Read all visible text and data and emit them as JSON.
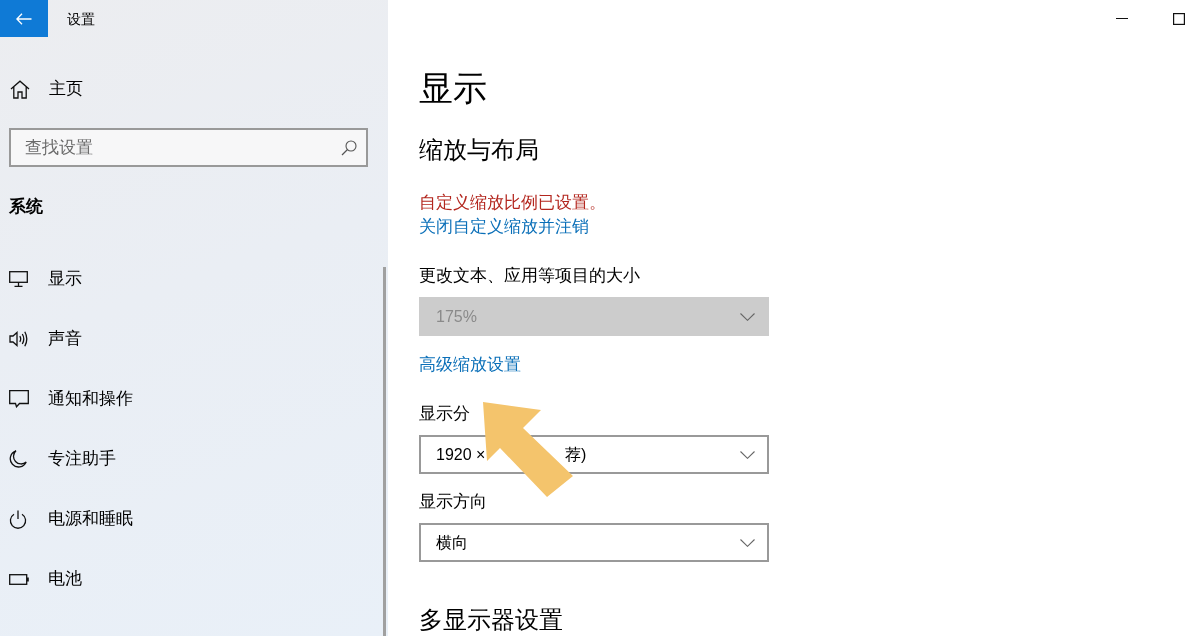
{
  "window": {
    "title": "设置"
  },
  "sidebar": {
    "home": {
      "label": "主页"
    },
    "search": {
      "placeholder": "查找设置"
    },
    "section": "系统",
    "items": [
      {
        "label": "显示"
      },
      {
        "label": "声音"
      },
      {
        "label": "通知和操作"
      },
      {
        "label": "专注助手"
      },
      {
        "label": "电源和睡眠"
      },
      {
        "label": "电池"
      }
    ]
  },
  "page": {
    "title": "显示",
    "section_title": "缩放与布局",
    "warning": "自定义缩放比例已设置。",
    "signout_link": "关闭自定义缩放并注销",
    "scale": {
      "label": "更改文本、应用等项目的大小",
      "value": "175%",
      "disabled": true
    },
    "advanced_link": "高级缩放设置",
    "resolution": {
      "label": "显示分",
      "value_parts": [
        "1920 ×",
        "荐)"
      ]
    },
    "orientation": {
      "label": "显示方向",
      "value": "横向"
    },
    "next_section_title": "多显示器设置"
  }
}
